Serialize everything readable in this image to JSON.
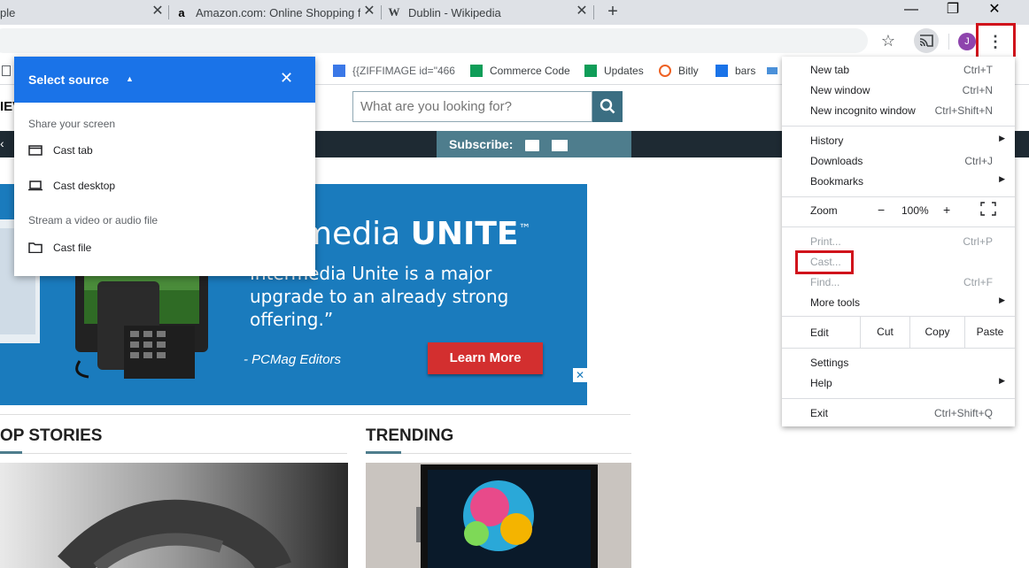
{
  "tabs": [
    {
      "title": "ple",
      "active": false
    },
    {
      "title": "Amazon.com: Online Shopping fo",
      "favicon": "a",
      "active": false
    },
    {
      "title": "Dublin - Wikipedia",
      "favicon": "W",
      "active": true
    }
  ],
  "new_tab_glyph": "+",
  "window_controls": {
    "minimize": "—",
    "restore": "❐",
    "close": "✕"
  },
  "toolbar": {
    "bookmark_star": "☆",
    "cast_icon": "cast-icon",
    "avatar_letter": "J",
    "menu_glyph": "⋮"
  },
  "bookmarks": [
    {
      "label": "{{ZIFFIMAGE id=\"466",
      "icon": "doc-icon",
      "color": "#3b78e7"
    },
    {
      "label": "Commerce Code",
      "icon": "sheet-icon",
      "color": "#0f9d58"
    },
    {
      "label": "Updates",
      "icon": "sheet-icon",
      "color": "#0f9d58"
    },
    {
      "label": "Bitly",
      "icon": "bitly-icon",
      "color": "#ee6123"
    },
    {
      "label": "bars",
      "icon": "flag-icon",
      "color": "#1a73e8"
    }
  ],
  "page": {
    "nav_partial": "IEV",
    "nav_left": "‹",
    "search_placeholder": "What are you looking for?",
    "subscribe_label": "Subscribe:",
    "ad": {
      "title_light": "media",
      "title_bold": "UNITE",
      "title_mark": "™",
      "quote": "Intermedia Unite is a major upgrade to an already strong offering.”",
      "attribution": "- PCMag Editors",
      "cta": "Learn More",
      "close": "✕"
    },
    "sections": {
      "top_stories": "OP STORIES",
      "trending": "TRENDING"
    }
  },
  "cast_dialog": {
    "title": "Select source",
    "share_label": "Share your screen",
    "items": [
      {
        "label": "Cast tab",
        "icon": "tab-icon"
      },
      {
        "label": "Cast desktop",
        "icon": "laptop-icon"
      }
    ],
    "stream_label": "Stream a video or audio file",
    "file_item": {
      "label": "Cast file",
      "icon": "folder-icon"
    }
  },
  "menu": {
    "group1": [
      {
        "label": "New tab",
        "shortcut": "Ctrl+T"
      },
      {
        "label": "New window",
        "shortcut": "Ctrl+N"
      },
      {
        "label": "New incognito window",
        "shortcut": "Ctrl+Shift+N"
      }
    ],
    "group2": [
      {
        "label": "History",
        "submenu": true
      },
      {
        "label": "Downloads",
        "shortcut": "Ctrl+J"
      },
      {
        "label": "Bookmarks",
        "submenu": true
      }
    ],
    "zoom": {
      "label": "Zoom",
      "minus": "−",
      "value": "100%",
      "plus": "+",
      "fullscreen": "⛶"
    },
    "group3": [
      {
        "label": "Print...",
        "shortcut": "Ctrl+P",
        "disabled": true
      },
      {
        "label": "Cast...",
        "disabled": true
      },
      {
        "label": "Find...",
        "shortcut": "Ctrl+F",
        "disabled": true
      },
      {
        "label": "More tools",
        "submenu": true
      }
    ],
    "edit": {
      "label": "Edit",
      "cut": "Cut",
      "copy": "Copy",
      "paste": "Paste"
    },
    "group4": [
      {
        "label": "Settings"
      },
      {
        "label": "Help",
        "submenu": true
      }
    ],
    "exit": {
      "label": "Exit",
      "shortcut": "Ctrl+Shift+Q"
    },
    "submenu_arrow": "▶"
  },
  "colors": {
    "accent": "#1a73e8",
    "highlight_box": "#d0121b",
    "ad_bg": "#1a7bbd",
    "cta": "#d32f2f"
  }
}
